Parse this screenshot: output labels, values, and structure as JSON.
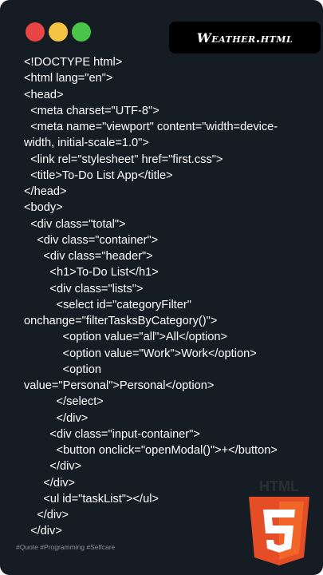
{
  "window": {
    "dot_colors": [
      "#e84444",
      "#f6c443",
      "#4bc44a"
    ]
  },
  "title": "Weather.html",
  "code_lines": [
    "<!DOCTYPE html>",
    "<html lang=\"en\">",
    "<head>",
    "  <meta charset=\"UTF-8\">",
    "  <meta name=\"viewport\" content=\"width=device-",
    "width, initial-scale=1.0\">",
    "  <link rel=\"stylesheet\" href=\"first.css\">",
    "  <title>To-Do List App</title>",
    "</head>",
    "<body>",
    "  <div class=\"total\">",
    "    <div class=\"container\">",
    "      <div class=\"header\">",
    "        <h1>To-Do List</h1>",
    "        <div class=\"lists\">",
    "          <select id=\"categoryFilter\"",
    "onchange=\"filterTasksByCategory()\">",
    "            <option value=\"all\">All</option>",
    "            <option value=\"Work\">Work</option>",
    "            <option",
    "value=\"Personal\">Personal</option>",
    "          </select>",
    "          </div>",
    "        <div class=\"input-container\">",
    "          <button onclick=\"openModal()\">+</button>",
    "        </div>",
    "      </div>",
    "      <ul id=\"taskList\"></ul>",
    "    </div>",
    "  </div>"
  ],
  "hashtags": "#Quote #Programming #Selfcare",
  "logo": {
    "label": "HTML",
    "digit": "5",
    "icon": "html5-logo-icon",
    "colors": {
      "shield_dark": "#e44d26",
      "shield_light": "#f16529",
      "text": "#ffffff"
    }
  }
}
